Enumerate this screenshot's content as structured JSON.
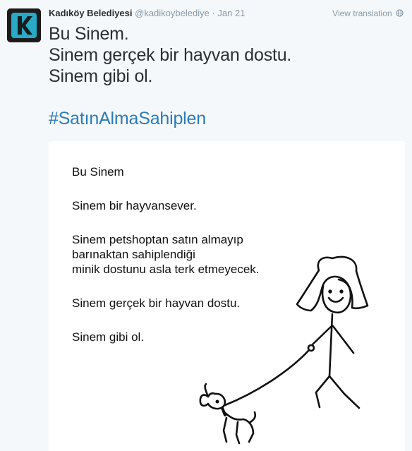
{
  "tweet": {
    "author_name": "Kadıköy Belediyesi",
    "screen_name": "@kadikoybelediye",
    "separator": "·",
    "timestamp": "Jan 21",
    "view_translation": "View translation",
    "avatar_letter": "K",
    "text_lines": [
      "Bu Sinem.",
      "Sinem gerçek bir hayvan dostu.",
      "Sinem gibi ol."
    ],
    "hashtag": "#SatınAlmaSahiplen"
  },
  "media": {
    "paragraphs": [
      [
        "Bu Sinem"
      ],
      [
        "Sinem bir hayvansever."
      ],
      [
        "Sinem petshoptan satın almayıp",
        "barınaktan sahiplendiği",
        "minik dostunu asla terk etmeyecek."
      ],
      [
        "Sinem gerçek bir hayvan dostu."
      ],
      [
        "Sinem gibi ol."
      ]
    ]
  },
  "colors": {
    "background": "#f5f8fa",
    "name": "#292f33",
    "meta": "#8899a6",
    "hashtag": "#2b7bb9",
    "avatar_bg": "#1b1b1b",
    "avatar_accent": "#27a9c7"
  },
  "icons": {
    "translation": "globe-icon"
  }
}
